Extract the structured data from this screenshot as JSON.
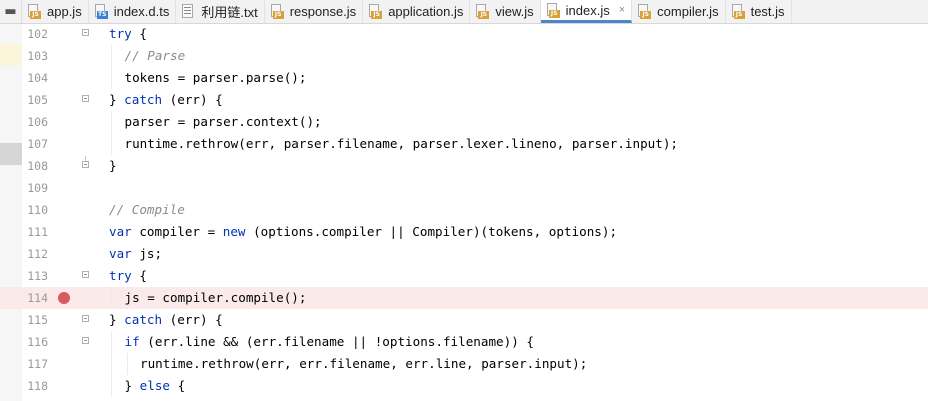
{
  "tabs": [
    {
      "label": "app.js",
      "type": "js",
      "active": false
    },
    {
      "label": "index.d.ts",
      "type": "ts",
      "active": false
    },
    {
      "label": "利用链.txt",
      "type": "txt",
      "active": false
    },
    {
      "label": "response.js",
      "type": "js",
      "active": false
    },
    {
      "label": "application.js",
      "type": "js",
      "active": false
    },
    {
      "label": "view.js",
      "type": "js",
      "active": false
    },
    {
      "label": "index.js",
      "type": "js",
      "active": true
    },
    {
      "label": "compiler.js",
      "type": "js",
      "active": false
    },
    {
      "label": "test.js",
      "type": "js",
      "active": false
    }
  ],
  "tab_icons": {
    "js": "JS",
    "ts": "TS"
  },
  "tab_close_glyph": "×",
  "lines": [
    {
      "num": "102",
      "fold": "start",
      "breakpoint": false,
      "indent": 0,
      "tokens": [
        {
          "t": "try",
          "k": "kw"
        },
        {
          "t": " {"
        }
      ]
    },
    {
      "num": "103",
      "fold": "",
      "breakpoint": false,
      "indent": 1,
      "tokens": [
        {
          "t": "// Parse",
          "k": "cm"
        }
      ]
    },
    {
      "num": "104",
      "fold": "",
      "breakpoint": false,
      "indent": 1,
      "tokens": [
        {
          "t": "tokens = parser.parse();"
        }
      ]
    },
    {
      "num": "105",
      "fold": "start",
      "breakpoint": false,
      "indent": 0,
      "tokens": [
        {
          "t": "} "
        },
        {
          "t": "catch",
          "k": "kw"
        },
        {
          "t": " (err) {"
        }
      ]
    },
    {
      "num": "106",
      "fold": "",
      "breakpoint": false,
      "indent": 1,
      "tokens": [
        {
          "t": "parser = parser.context();"
        }
      ]
    },
    {
      "num": "107",
      "fold": "",
      "breakpoint": false,
      "indent": 1,
      "tokens": [
        {
          "t": "runtime.rethrow(err, parser.filename, parser.lexer.lineno, parser.input);"
        }
      ]
    },
    {
      "num": "108",
      "fold": "end",
      "breakpoint": false,
      "indent": 0,
      "tokens": [
        {
          "t": "}"
        }
      ]
    },
    {
      "num": "109",
      "fold": "",
      "breakpoint": false,
      "indent": 0,
      "tokens": []
    },
    {
      "num": "110",
      "fold": "",
      "breakpoint": false,
      "indent": 0,
      "tokens": [
        {
          "t": "// Compile",
          "k": "cm"
        }
      ]
    },
    {
      "num": "111",
      "fold": "",
      "breakpoint": false,
      "indent": 0,
      "tokens": [
        {
          "t": "var",
          "k": "kw"
        },
        {
          "t": " compiler = "
        },
        {
          "t": "new",
          "k": "kw"
        },
        {
          "t": " (options.compiler || Compiler)(tokens, options);"
        }
      ]
    },
    {
      "num": "112",
      "fold": "",
      "breakpoint": false,
      "indent": 0,
      "tokens": [
        {
          "t": "var",
          "k": "kw"
        },
        {
          "t": " js;"
        }
      ]
    },
    {
      "num": "113",
      "fold": "start",
      "breakpoint": false,
      "indent": 0,
      "tokens": [
        {
          "t": "try",
          "k": "kw"
        },
        {
          "t": " {"
        }
      ]
    },
    {
      "num": "114",
      "fold": "",
      "breakpoint": true,
      "indent": 1,
      "tokens": [
        {
          "t": "js = compiler.compile();"
        }
      ]
    },
    {
      "num": "115",
      "fold": "start",
      "breakpoint": false,
      "indent": 0,
      "tokens": [
        {
          "t": "} "
        },
        {
          "t": "catch",
          "k": "kw"
        },
        {
          "t": " (err) {"
        }
      ]
    },
    {
      "num": "116",
      "fold": "start",
      "breakpoint": false,
      "indent": 1,
      "tokens": [
        {
          "t": "if",
          "k": "kw"
        },
        {
          "t": " (err.line && (err.filename || !options.filename)) {"
        }
      ]
    },
    {
      "num": "117",
      "fold": "",
      "breakpoint": false,
      "indent": 2,
      "tokens": [
        {
          "t": "runtime.rethrow(err, err.filename, err.line, parser.input);"
        }
      ]
    },
    {
      "num": "118",
      "fold": "",
      "breakpoint": false,
      "indent": 1,
      "tokens": [
        {
          "t": "} "
        },
        {
          "t": "else",
          "k": "kw"
        },
        {
          "t": " {"
        }
      ]
    }
  ],
  "colors": {
    "keyword": "#0033b3",
    "comment": "#8c8c8c",
    "breakpoint": "#db5860",
    "breakpoint_line": "#faeaea",
    "active_tab_underline": "#4a86c8"
  }
}
